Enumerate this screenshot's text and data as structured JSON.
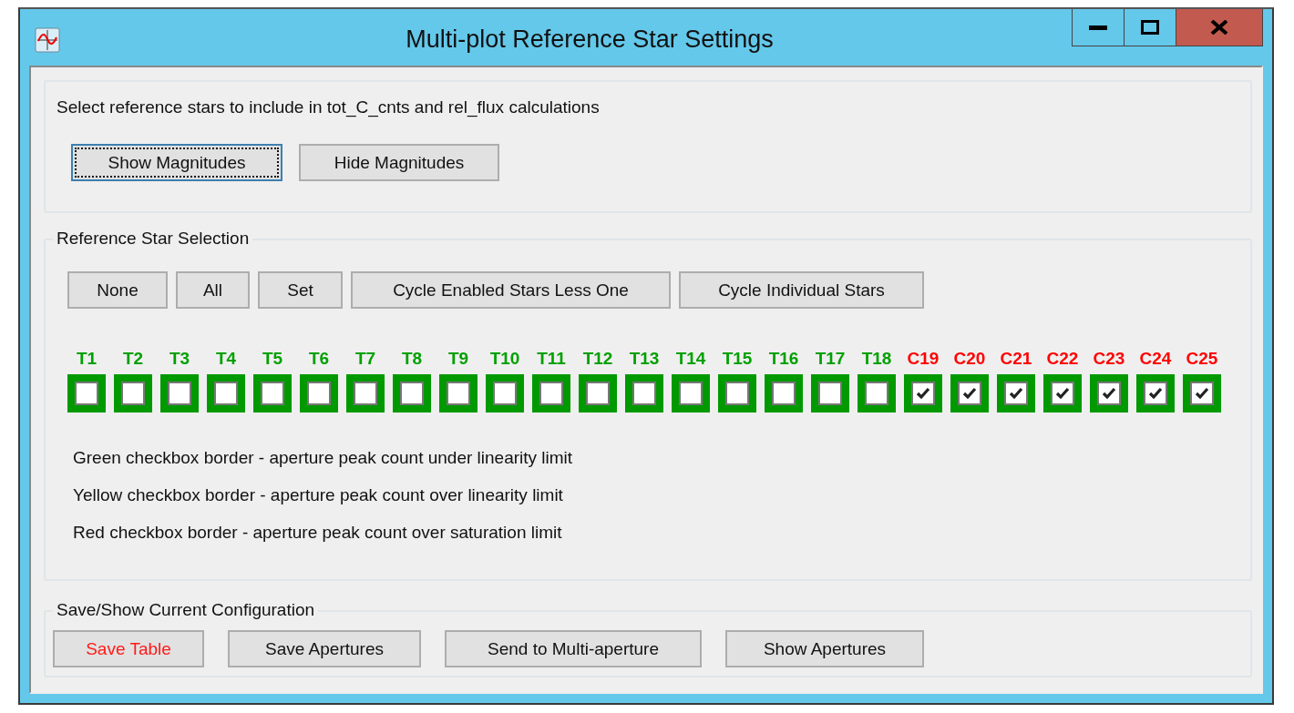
{
  "window": {
    "title": "Multi-plot Reference Star Settings"
  },
  "intro": {
    "text": "Select reference stars to include in tot_C_cnts and rel_flux calculations",
    "buttons": [
      {
        "label": "Show Magnitudes",
        "focused": true
      },
      {
        "label": "Hide Magnitudes",
        "focused": false
      }
    ]
  },
  "selection": {
    "title": "Reference Star Selection",
    "buttons": [
      "None",
      "All",
      "Set",
      "Cycle Enabled Stars Less One",
      "Cycle Individual Stars"
    ],
    "stars": [
      {
        "label": "T1",
        "checked": false,
        "color": "#00a000"
      },
      {
        "label": "T2",
        "checked": false,
        "color": "#00a000"
      },
      {
        "label": "T3",
        "checked": false,
        "color": "#00a000"
      },
      {
        "label": "T4",
        "checked": false,
        "color": "#00a000"
      },
      {
        "label": "T5",
        "checked": false,
        "color": "#00a000"
      },
      {
        "label": "T6",
        "checked": false,
        "color": "#00a000"
      },
      {
        "label": "T7",
        "checked": false,
        "color": "#00a000"
      },
      {
        "label": "T8",
        "checked": false,
        "color": "#00a000"
      },
      {
        "label": "T9",
        "checked": false,
        "color": "#00a000"
      },
      {
        "label": "T10",
        "checked": false,
        "color": "#00a000"
      },
      {
        "label": "T11",
        "checked": false,
        "color": "#00a000"
      },
      {
        "label": "T12",
        "checked": false,
        "color": "#00a000"
      },
      {
        "label": "T13",
        "checked": false,
        "color": "#00a000"
      },
      {
        "label": "T14",
        "checked": false,
        "color": "#00a000"
      },
      {
        "label": "T15",
        "checked": false,
        "color": "#00a000"
      },
      {
        "label": "T16",
        "checked": false,
        "color": "#00a000"
      },
      {
        "label": "T17",
        "checked": false,
        "color": "#00a000"
      },
      {
        "label": "T18",
        "checked": false,
        "color": "#00a000"
      },
      {
        "label": "C19",
        "checked": true,
        "color": "#ff0000"
      },
      {
        "label": "C20",
        "checked": true,
        "color": "#ff0000"
      },
      {
        "label": "C21",
        "checked": true,
        "color": "#ff0000"
      },
      {
        "label": "C22",
        "checked": true,
        "color": "#ff0000"
      },
      {
        "label": "C23",
        "checked": true,
        "color": "#ff0000"
      },
      {
        "label": "C24",
        "checked": true,
        "color": "#ff0000"
      },
      {
        "label": "C25",
        "checked": true,
        "color": "#ff0000"
      }
    ],
    "legend": [
      "Green checkbox border - aperture peak count under linearity limit",
      "Yellow checkbox border - aperture peak count over linearity limit",
      "Red checkbox border - aperture peak count over saturation limit"
    ]
  },
  "save": {
    "title": "Save/Show Current Configuration",
    "buttons": [
      {
        "label": "Save Table",
        "warning": true
      },
      {
        "label": "Save Apertures",
        "warning": false
      },
      {
        "label": "Send to Multi-aperture",
        "warning": false
      },
      {
        "label": "Show Apertures",
        "warning": false
      }
    ]
  }
}
